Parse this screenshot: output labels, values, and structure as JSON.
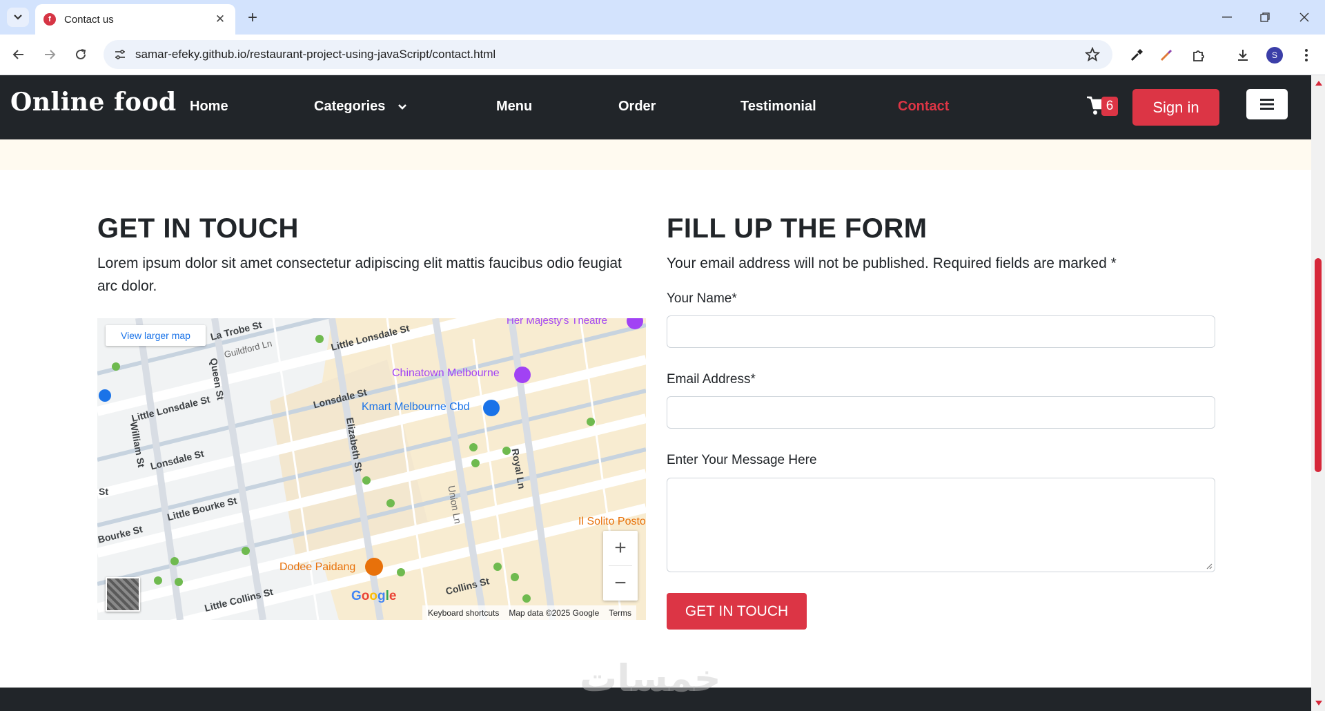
{
  "browser": {
    "tab_title": "Contact us",
    "url": "samar-efeky.github.io/restaurant-project-using-javaScript/contact.html",
    "profile_initial": "S"
  },
  "nav": {
    "brand": "Online food",
    "links": [
      "Home",
      "Categories",
      "Menu",
      "Order",
      "Testimonial",
      "Contact"
    ],
    "active_link": "Contact",
    "cart_count": "6",
    "signin": "Sign in"
  },
  "contact": {
    "title": "GET IN TOUCH",
    "text": "Lorem ipsum dolor sit amet consectetur adipiscing elit mattis faucibus odio feugiat arc dolor."
  },
  "map": {
    "larger_map": "View larger map",
    "places": {
      "theatre": "Her Majesty's Theatre",
      "chinatown": "Chinatown Melbourne",
      "kmart": "Kmart Melbourne Cbd",
      "solito": "Il Solito Posto",
      "dodee": "Dodee Paidang"
    },
    "streets": [
      "La Trobe St",
      "Guildford Ln",
      "Little Lonsdale St",
      "Queen St",
      "Little Lonsdale St",
      "Lonsdale St",
      "William St",
      "Lonsdale St",
      "Elizabeth St",
      "Royal Ln",
      "Union Ln",
      "St",
      "Little Bourke St",
      "Bourke St",
      "Little Collins St",
      "Collins St"
    ],
    "google": "Google",
    "attribution": [
      "Keyboard shortcuts",
      "Map data ©2025 Google",
      "Terms"
    ]
  },
  "form": {
    "title": "FILL UP THE FORM",
    "note": "Your email address will not be published. Required fields are marked *",
    "name_label": "Your Name*",
    "email_label": "Email Address*",
    "message_label": "Enter Your Message Here",
    "submit": "GET IN TOUCH"
  },
  "colors": {
    "accent": "#dc3545",
    "navbar": "#212529",
    "band": "#fffaf0"
  },
  "icons": [
    "tab-search-icon",
    "favicon-icon",
    "close-icon",
    "plus-icon",
    "minimize-icon",
    "restore-icon",
    "window-close-icon",
    "back-icon",
    "forward-icon",
    "reload-icon",
    "site-info-icon",
    "star-icon",
    "eyedropper-icon",
    "paint-icon",
    "extensions-icon",
    "download-icon",
    "kebab-menu-icon",
    "cart-icon",
    "menu-icon",
    "chevron-down-icon"
  ]
}
